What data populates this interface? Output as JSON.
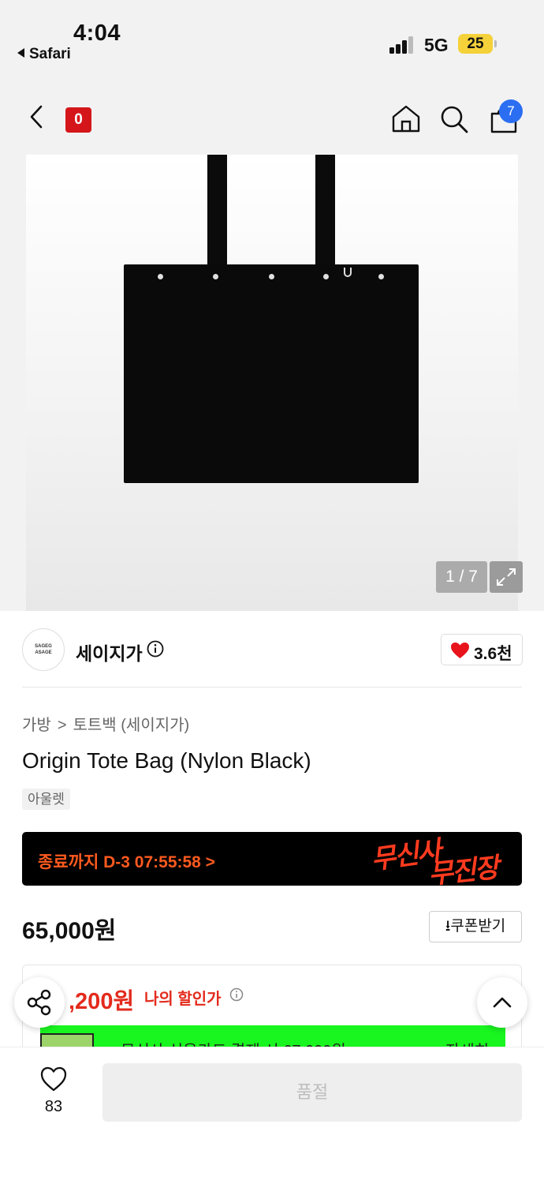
{
  "status_bar": {
    "time": "4:04",
    "back_app": "Safari",
    "network": "5G",
    "battery": "25"
  },
  "header": {
    "logo_text": "0",
    "cart_count": "7",
    "brand_color": "#d4161a",
    "badge_color": "#2b6ef2"
  },
  "gallery": {
    "counter": "1 / 7"
  },
  "brand": {
    "avatar_line1": "SAGEG",
    "avatar_line2": "ASAGE",
    "name": "세이지가",
    "likes": "3.6천"
  },
  "product": {
    "breadcrumb": [
      "가방",
      "토트백 (세이지가)"
    ],
    "title": "Origin Tote Bag (Nylon Black)",
    "tag": "아울렛"
  },
  "banner": {
    "countdown": "종료까지 D-3 07:55:58 >",
    "brush_line1": "무신사",
    "brush_line2": "무진장"
  },
  "price": {
    "amount": "65,000원",
    "coupon_label": "쿠폰받기"
  },
  "discount": {
    "amount": ",200원",
    "label": "나의 할인가",
    "strip_text": "무신사 신용카드 결제 시 67,000원",
    "strip_more": "자세히"
  },
  "bottom": {
    "wish_count": "83",
    "soldout_label": "품절"
  }
}
